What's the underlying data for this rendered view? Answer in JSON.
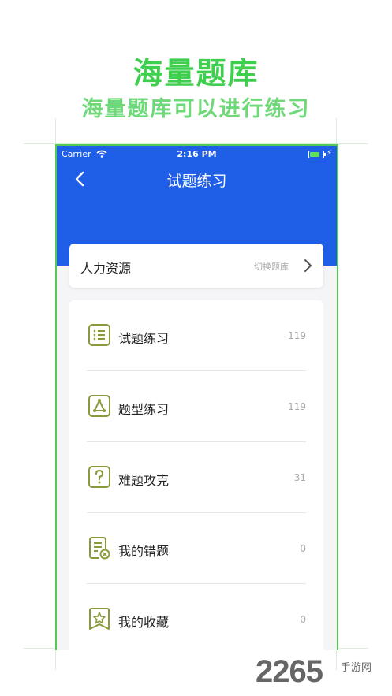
{
  "promo": {
    "title": "海量题库",
    "subtitle": "海量题库可以进行练习"
  },
  "status_bar": {
    "carrier": "Carrier",
    "time": "2:16 PM"
  },
  "nav": {
    "title": "试题练习",
    "back_icon": "chevron-left-icon"
  },
  "subject_card": {
    "name": "人力资源",
    "switch_label": "切换题库"
  },
  "menu": [
    {
      "label": "试题练习",
      "count": "119",
      "icon": "list-icon"
    },
    {
      "label": "题型练习",
      "count": "119",
      "icon": "triangle-nodes-icon"
    },
    {
      "label": "难题攻克",
      "count": "31",
      "icon": "question-icon"
    },
    {
      "label": "我的错题",
      "count": "0",
      "icon": "wrong-doc-icon"
    },
    {
      "label": "我的收藏",
      "count": "0",
      "icon": "star-bookmark-icon"
    }
  ],
  "watermark": {
    "number": "2265",
    "site": "手游网"
  },
  "colors": {
    "primary": "#1f5fe8",
    "accent_green": "#3fcf4e",
    "icon_green": "#8a9a3a"
  }
}
